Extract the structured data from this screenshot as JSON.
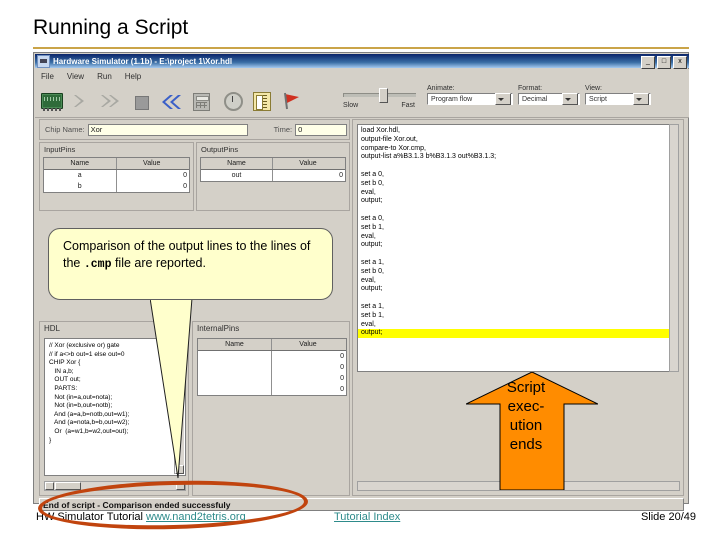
{
  "slide": {
    "title": "Running a Script",
    "number": "Slide 20/49"
  },
  "window": {
    "title": "Hardware Simulator (1.1b) - E:\\project 1\\Xor.hdl",
    "buttons": {
      "minimize": "_",
      "maximize": "□",
      "close": "x"
    },
    "menu": [
      "File",
      "View",
      "Run",
      "Help"
    ]
  },
  "toolbar": {
    "icons": [
      "chip-icon",
      "step-icon",
      "run-icon",
      "stop-icon",
      "rewind-icon",
      "calculator-icon",
      "clock-icon",
      "script-icon",
      "flag-icon"
    ],
    "slider": {
      "min_label": "Slow",
      "max_label": "Fast"
    },
    "combos": [
      {
        "label": "Animate:",
        "value": "Program flow"
      },
      {
        "label": "Format:",
        "value": "Decimal"
      },
      {
        "label": "View:",
        "value": "Script"
      }
    ]
  },
  "chip": {
    "name_label": "Chip Name:",
    "name_value": "Xor",
    "time_label": "Time:",
    "time_value": "0"
  },
  "input_pins": {
    "title": "InputPins",
    "columns": [
      "Name",
      "Value"
    ],
    "rows": [
      {
        "name": "a",
        "value": "0"
      },
      {
        "name": "b",
        "value": "0"
      }
    ]
  },
  "output_pins": {
    "title": "OutputPins",
    "columns": [
      "Name",
      "Value"
    ],
    "rows": [
      {
        "name": "out",
        "value": "0"
      }
    ]
  },
  "hdl": {
    "label": "HDL",
    "lines": [
      "// Xor (exclusive or) gate",
      "// if a<>b out=1 else out=0",
      "CHIP Xor {",
      "   IN a,b;",
      "   OUT out;",
      "   PARTS:",
      "   Not (in=a,out=nota);",
      "   Not (in=b,out=notb);",
      "   And (a=a,b=notb,out=w1);",
      "   And (a=nota,b=b,out=w2);",
      "   Or  (a=w1,b=w2,out=out);",
      "}",
      ""
    ]
  },
  "internal_pins": {
    "title": "InternalPins",
    "columns": [
      "Name",
      "Value"
    ],
    "rows": [
      {
        "name": "",
        "value": "0"
      },
      {
        "name": "",
        "value": "0"
      },
      {
        "name": "",
        "value": "0"
      },
      {
        "name": "",
        "value": "0"
      }
    ]
  },
  "script": {
    "lines": [
      {
        "text": "load Xor.hdl,",
        "highlight": false
      },
      {
        "text": "output-file Xor.out,",
        "highlight": false
      },
      {
        "text": "compare-to Xor.cmp,",
        "highlight": false
      },
      {
        "text": "output-list a%B3.1.3 b%B3.1.3 out%B3.1.3;",
        "highlight": false
      },
      {
        "text": "",
        "highlight": false
      },
      {
        "text": "set a 0,",
        "highlight": false
      },
      {
        "text": "set b 0,",
        "highlight": false
      },
      {
        "text": "eval,",
        "highlight": false
      },
      {
        "text": "output;",
        "highlight": false
      },
      {
        "text": "",
        "highlight": false
      },
      {
        "text": "set a 0,",
        "highlight": false
      },
      {
        "text": "set b 1,",
        "highlight": false
      },
      {
        "text": "eval,",
        "highlight": false
      },
      {
        "text": "output;",
        "highlight": false
      },
      {
        "text": "",
        "highlight": false
      },
      {
        "text": "set a 1,",
        "highlight": false
      },
      {
        "text": "set b 0,",
        "highlight": false
      },
      {
        "text": "eval,",
        "highlight": false
      },
      {
        "text": "output;",
        "highlight": false
      },
      {
        "text": "",
        "highlight": false
      },
      {
        "text": "set a 1,",
        "highlight": false
      },
      {
        "text": "set b 1,",
        "highlight": false
      },
      {
        "text": "eval,",
        "highlight": false
      },
      {
        "text": "output;",
        "highlight": true
      }
    ]
  },
  "status": {
    "message": "End of script - Comparison ended successfuly"
  },
  "callout": {
    "text_before": "Comparison of the output lines to the lines of the ",
    "mono": ".cmp",
    "text_after": " file are reported."
  },
  "annotation_arrow": {
    "label_lines": [
      "Script",
      "exec-",
      "ution",
      "ends"
    ],
    "color": "#FF8C00"
  },
  "colors": {
    "highlight": "#FFFF00",
    "arrow_orange": "#FF8C00",
    "ellipse_red": "#C1440E",
    "callout_bg": "#FFFFCC",
    "link": "#2E8B8B",
    "titlebar_blue": "#0A246A"
  },
  "footer": {
    "left_text": "HW Simulator Tutorial ",
    "left_link": "www.nand2tetris.org",
    "mid_link": "Tutorial Index",
    "right_text": "Slide 20/49"
  }
}
